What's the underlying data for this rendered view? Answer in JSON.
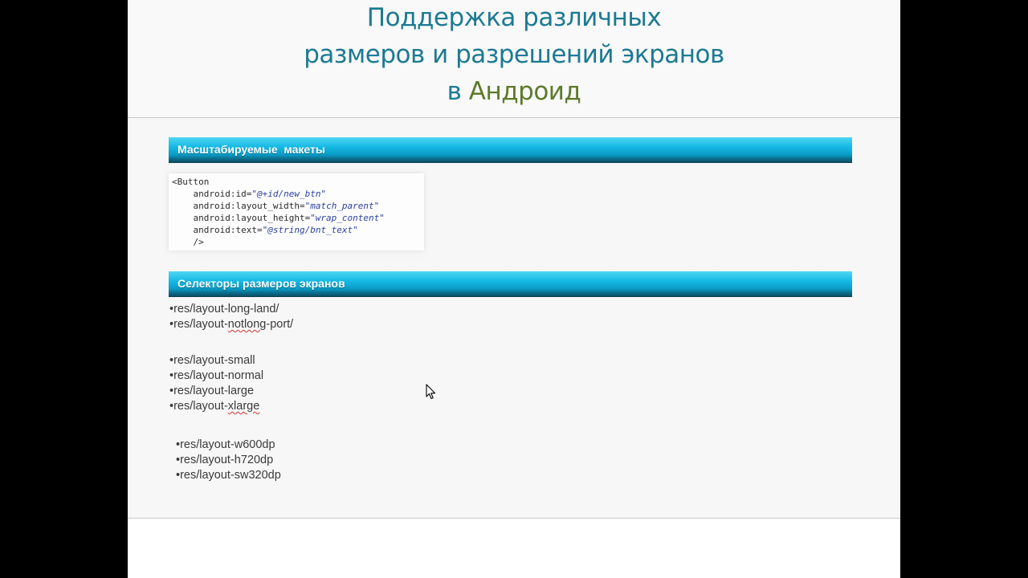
{
  "title": {
    "line1": "Поддержка различных",
    "line2": "размеров и разрешений экранов",
    "line3_prefix": "в ",
    "line3_accent": "Андроид"
  },
  "sections": [
    {
      "label": "Масштабируемые  макеты"
    },
    {
      "label": "Селекторы размеров экранов"
    }
  ],
  "code": {
    "open": "<Button",
    "lines": [
      {
        "attr": "    android:id=",
        "value": "\"@+id/new_btn\""
      },
      {
        "attr": "    android:layout_width=",
        "value": "\"match_parent\""
      },
      {
        "attr": "    android:layout_height=",
        "value": "\"wrap_content\""
      },
      {
        "attr": "    android:text=",
        "value": "\"@string/bnt_text\""
      }
    ],
    "close": "    />"
  },
  "selectors": {
    "group1": [
      "•res/layout-long-land/",
      "•res/layout-notlong-port/"
    ],
    "group2": [
      "•res/layout-small",
      "•res/layout-normal",
      "•res/layout-large",
      "•res/layout-xlarge"
    ],
    "group3": [
      "•res/layout-w600dp",
      "•res/layout-h720dp",
      "•res/layout-sw320dp"
    ]
  },
  "colors": {
    "title": "#1c7a93",
    "title_accent": "#5d7a2a",
    "section_bar": "#14b8e3"
  }
}
